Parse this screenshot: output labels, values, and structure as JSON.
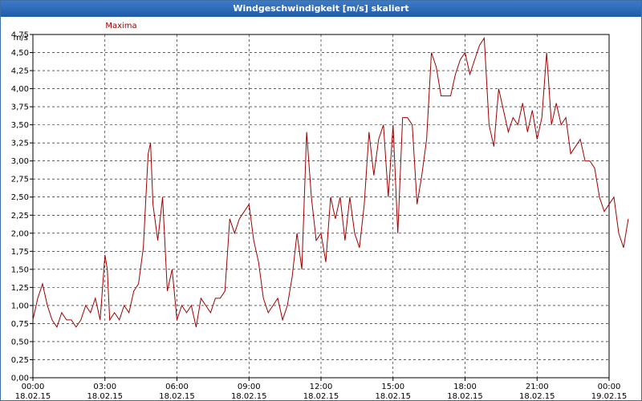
{
  "window": {
    "title": "Windgeschwindigkeit [m/s] skaliert"
  },
  "chart_data": {
    "type": "line",
    "title": "Windgeschwindigkeit [m/s] skaliert",
    "unit_label": "m/s",
    "ylim": [
      0,
      4.75
    ],
    "yticks": [
      "0,00",
      "0,25",
      "0,50",
      "0,75",
      "1,00",
      "1,25",
      "1,50",
      "1,75",
      "2,00",
      "2,25",
      "2,50",
      "2,75",
      "3,00",
      "3,25",
      "3,50",
      "3,75",
      "4,00",
      "4,25",
      "4,50",
      "4,75"
    ],
    "xlim_hours": [
      0,
      24
    ],
    "xticks": [
      {
        "time": "00:00",
        "date": "18.02.15"
      },
      {
        "time": "03:00",
        "date": "18.02.15"
      },
      {
        "time": "06:00",
        "date": "18.02.15"
      },
      {
        "time": "09:00",
        "date": "18.02.15"
      },
      {
        "time": "12:00",
        "date": "18.02.15"
      },
      {
        "time": "15:00",
        "date": "18.02.15"
      },
      {
        "time": "18:00",
        "date": "18.02.15"
      },
      {
        "time": "21:00",
        "date": "18.02.15"
      },
      {
        "time": "00:00",
        "date": "19.02.15"
      }
    ],
    "grid": true,
    "series": [
      {
        "name": "Maxima",
        "color": "#a00000",
        "points": [
          [
            0,
            0.8
          ],
          [
            0.2,
            1.1
          ],
          [
            0.4,
            1.3
          ],
          [
            0.6,
            1.0
          ],
          [
            0.8,
            0.8
          ],
          [
            1.0,
            0.7
          ],
          [
            1.2,
            0.9
          ],
          [
            1.4,
            0.8
          ],
          [
            1.6,
            0.8
          ],
          [
            1.8,
            0.7
          ],
          [
            2.0,
            0.8
          ],
          [
            2.2,
            1.0
          ],
          [
            2.4,
            0.9
          ],
          [
            2.6,
            1.1
          ],
          [
            2.8,
            0.8
          ],
          [
            3.0,
            1.7
          ],
          [
            3.1,
            1.5
          ],
          [
            3.2,
            0.8
          ],
          [
            3.4,
            0.9
          ],
          [
            3.6,
            0.8
          ],
          [
            3.8,
            1.0
          ],
          [
            4.0,
            0.9
          ],
          [
            4.2,
            1.2
          ],
          [
            4.4,
            1.3
          ],
          [
            4.6,
            1.8
          ],
          [
            4.8,
            3.1
          ],
          [
            4.9,
            3.25
          ],
          [
            5.0,
            2.4
          ],
          [
            5.2,
            1.9
          ],
          [
            5.4,
            2.5
          ],
          [
            5.6,
            1.2
          ],
          [
            5.8,
            1.5
          ],
          [
            6.0,
            0.8
          ],
          [
            6.2,
            1.0
          ],
          [
            6.4,
            0.9
          ],
          [
            6.6,
            1.0
          ],
          [
            6.8,
            0.7
          ],
          [
            7.0,
            1.1
          ],
          [
            7.2,
            1.0
          ],
          [
            7.4,
            0.9
          ],
          [
            7.6,
            1.1
          ],
          [
            7.8,
            1.1
          ],
          [
            8.0,
            1.2
          ],
          [
            8.2,
            2.2
          ],
          [
            8.4,
            2.0
          ],
          [
            8.6,
            2.2
          ],
          [
            8.8,
            2.3
          ],
          [
            9.0,
            2.4
          ],
          [
            9.2,
            1.9
          ],
          [
            9.4,
            1.6
          ],
          [
            9.6,
            1.1
          ],
          [
            9.8,
            0.9
          ],
          [
            10.0,
            1.0
          ],
          [
            10.2,
            1.1
          ],
          [
            10.4,
            0.8
          ],
          [
            10.6,
            1.0
          ],
          [
            10.8,
            1.4
          ],
          [
            11.0,
            2.0
          ],
          [
            11.2,
            1.5
          ],
          [
            11.4,
            3.4
          ],
          [
            11.6,
            2.5
          ],
          [
            11.8,
            1.9
          ],
          [
            12.0,
            2.0
          ],
          [
            12.2,
            1.6
          ],
          [
            12.4,
            2.5
          ],
          [
            12.6,
            2.2
          ],
          [
            12.8,
            2.5
          ],
          [
            13.0,
            1.9
          ],
          [
            13.2,
            2.5
          ],
          [
            13.4,
            2.0
          ],
          [
            13.6,
            1.8
          ],
          [
            13.8,
            2.4
          ],
          [
            14.0,
            3.4
          ],
          [
            14.2,
            2.8
          ],
          [
            14.4,
            3.3
          ],
          [
            14.6,
            3.5
          ],
          [
            14.8,
            2.5
          ],
          [
            15.0,
            3.5
          ],
          [
            15.2,
            2.0
          ],
          [
            15.4,
            3.6
          ],
          [
            15.6,
            3.6
          ],
          [
            15.8,
            3.5
          ],
          [
            16.0,
            2.4
          ],
          [
            16.2,
            2.8
          ],
          [
            16.4,
            3.3
          ],
          [
            16.6,
            4.5
          ],
          [
            16.8,
            4.3
          ],
          [
            17.0,
            3.9
          ],
          [
            17.2,
            3.9
          ],
          [
            17.4,
            3.9
          ],
          [
            17.6,
            4.2
          ],
          [
            17.8,
            4.4
          ],
          [
            18.0,
            4.5
          ],
          [
            18.2,
            4.2
          ],
          [
            18.4,
            4.4
          ],
          [
            18.6,
            4.6
          ],
          [
            18.8,
            4.7
          ],
          [
            19.0,
            3.5
          ],
          [
            19.2,
            3.2
          ],
          [
            19.4,
            4.0
          ],
          [
            19.6,
            3.7
          ],
          [
            19.8,
            3.4
          ],
          [
            20.0,
            3.6
          ],
          [
            20.2,
            3.5
          ],
          [
            20.4,
            3.8
          ],
          [
            20.6,
            3.4
          ],
          [
            20.8,
            3.7
          ],
          [
            21.0,
            3.3
          ],
          [
            21.2,
            3.6
          ],
          [
            21.4,
            4.5
          ],
          [
            21.6,
            3.5
          ],
          [
            21.8,
            3.8
          ],
          [
            22.0,
            3.5
          ],
          [
            22.2,
            3.6
          ],
          [
            22.4,
            3.1
          ],
          [
            22.6,
            3.2
          ],
          [
            22.8,
            3.3
          ],
          [
            23.0,
            3.0
          ],
          [
            23.2,
            3.0
          ],
          [
            23.4,
            2.9
          ],
          [
            23.6,
            2.5
          ],
          [
            23.8,
            2.3
          ],
          [
            24.0,
            2.4
          ],
          [
            24.2,
            2.5
          ],
          [
            24.4,
            2.0
          ],
          [
            24.6,
            1.8
          ],
          [
            24.8,
            2.2
          ]
        ]
      }
    ]
  }
}
